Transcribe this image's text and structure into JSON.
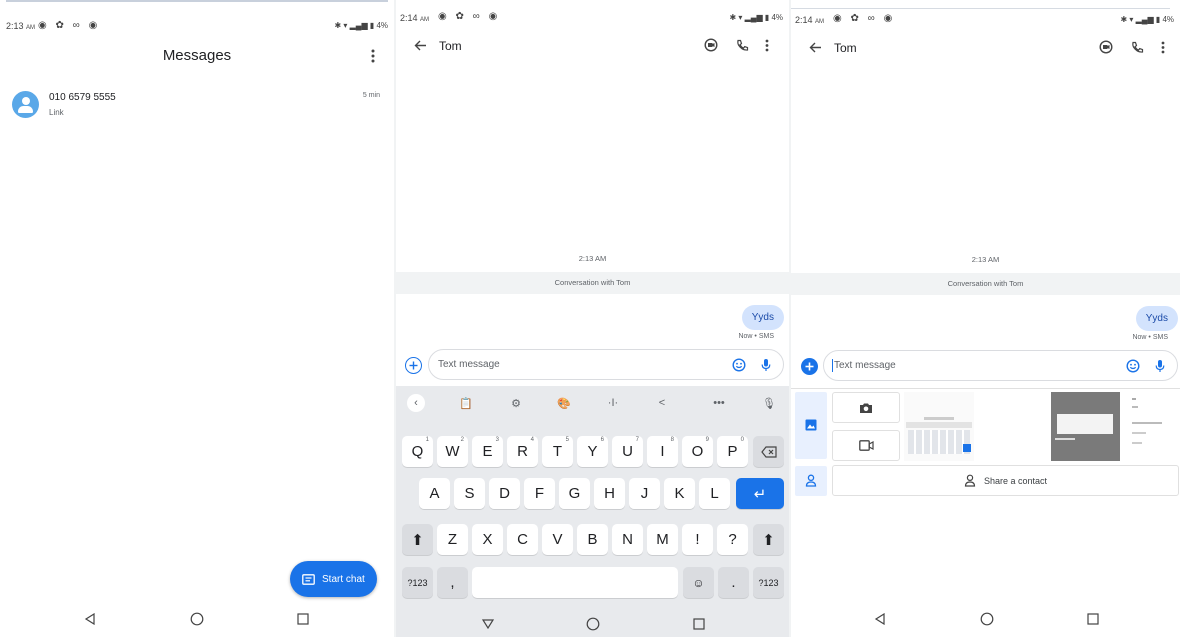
{
  "colors": {
    "accent": "#1a73e8",
    "bubble_bg": "#d3e3fd",
    "avatar": "#5aa8e8",
    "keyboard_bg": "#e8eaed"
  },
  "screen1": {
    "status": {
      "time": "2:13",
      "ampm": "AM",
      "battery": "4%"
    },
    "title": "Messages",
    "conversation": {
      "name": "010 6579 5555",
      "snippet": "Link",
      "time": "5 min"
    },
    "fab_label": "Start chat"
  },
  "screen2": {
    "status": {
      "time": "2:14",
      "ampm": "AM",
      "battery": "4%"
    },
    "contact": "Tom",
    "timestamp": "2:13 AM",
    "banner": "Conversation with Tom",
    "message": {
      "text": "Yyds",
      "meta": "Now • SMS"
    },
    "compose_placeholder": "Text message",
    "keyboard": {
      "row1": [
        {
          "k": "Q",
          "n": "1"
        },
        {
          "k": "W",
          "n": "2"
        },
        {
          "k": "E",
          "n": "3"
        },
        {
          "k": "R",
          "n": "4"
        },
        {
          "k": "T",
          "n": "5"
        },
        {
          "k": "Y",
          "n": "6"
        },
        {
          "k": "U",
          "n": "7"
        },
        {
          "k": "I",
          "n": "8"
        },
        {
          "k": "O",
          "n": "9"
        },
        {
          "k": "P",
          "n": "0"
        }
      ],
      "row2": [
        "A",
        "S",
        "D",
        "F",
        "G",
        "H",
        "J",
        "K",
        "L"
      ],
      "row3": [
        "Z",
        "X",
        "C",
        "V",
        "B",
        "N",
        "M",
        "!",
        "?"
      ],
      "symbols": "?123",
      "comma": ",",
      "period": "."
    }
  },
  "screen3": {
    "status": {
      "time": "2:14",
      "ampm": "AM",
      "battery": "4%"
    },
    "contact": "Tom",
    "timestamp": "2:13 AM",
    "banner": "Conversation with Tom",
    "message": {
      "text": "Yyds",
      "meta": "Now • SMS"
    },
    "compose_placeholder": "Text message",
    "share_contact": "Share a contact"
  }
}
